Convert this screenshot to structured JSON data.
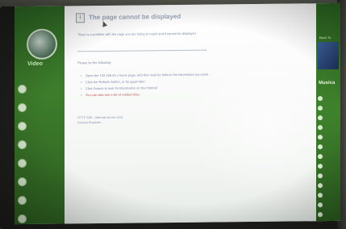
{
  "page": {
    "error_title": "The page cannot be displayed",
    "intro": "There is a problem with the page you are trying to reach and it cannot be displayed.",
    "try_heading": "Please try the following:",
    "bullets": [
      "Open the 192.168.25.x home page, and then look for links to the information you want.",
      "Click the Refresh button, or try again later.",
      "Click Search to look for information on the Internet.",
      "You can also see a list of related sites."
    ],
    "http_line1": "HTTP 500 - Internal server error",
    "http_line2": "Internet Explorer"
  },
  "left_sidebar": {
    "section": "Video",
    "items": [
      "",
      "",
      "",
      "",
      "",
      "",
      "",
      "",
      "",
      ""
    ]
  },
  "right_sidebar": {
    "promo_text": "Back To",
    "section": "Musica",
    "items": [
      "",
      "",
      "",
      "",
      "",
      "",
      "",
      "",
      "",
      "",
      "",
      "",
      "",
      "",
      ""
    ]
  }
}
